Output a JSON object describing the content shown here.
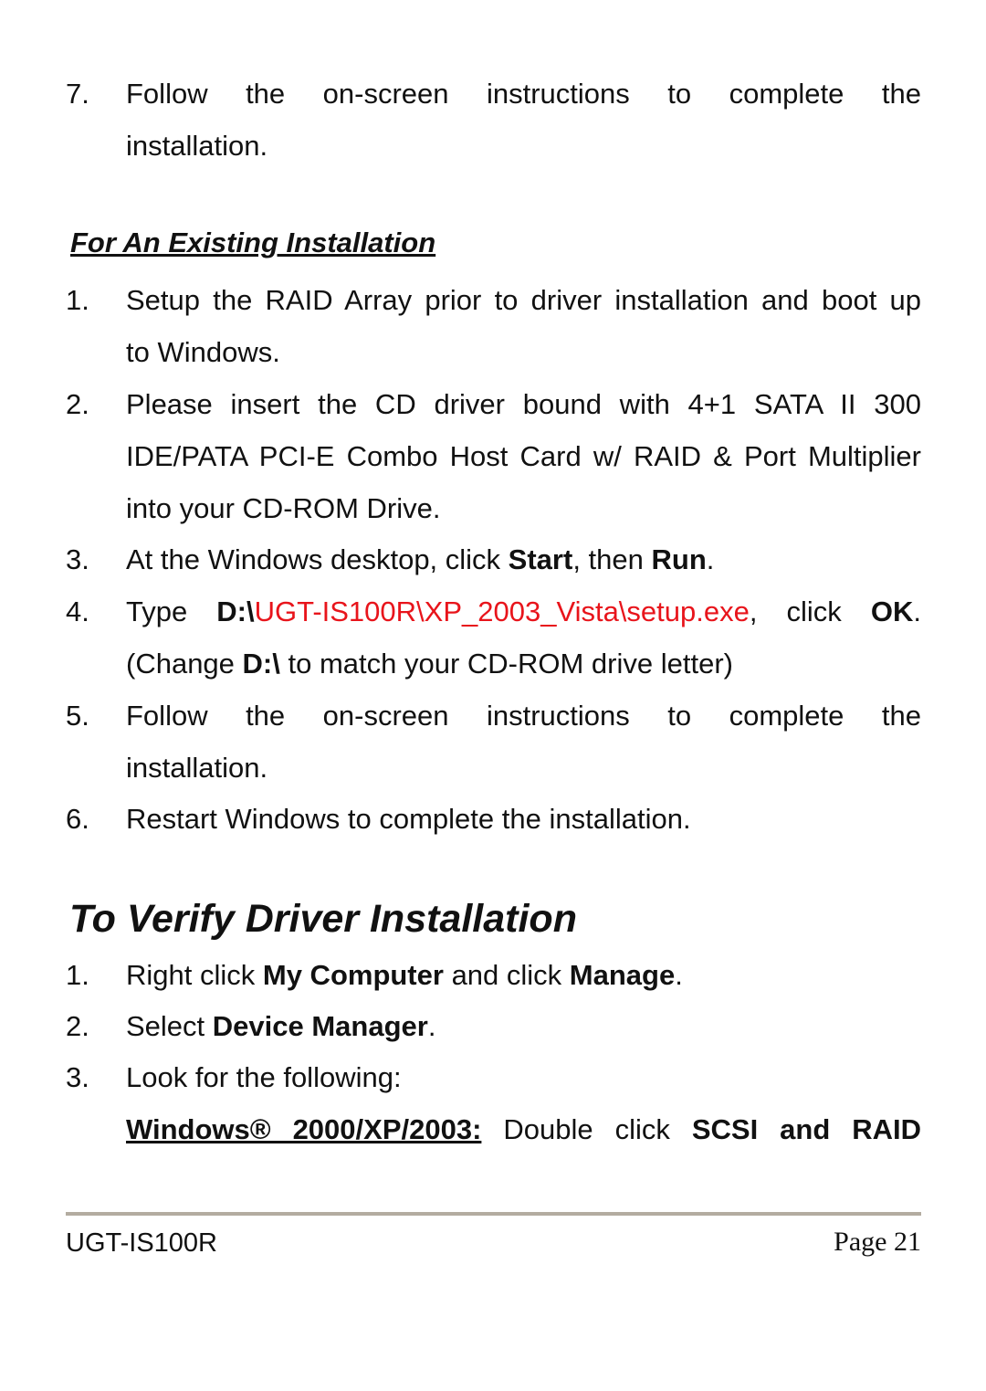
{
  "prev_section": {
    "step7": {
      "num": "7.",
      "line1": "Follow the on-screen instructions to complete the",
      "line2": "installation."
    }
  },
  "existing": {
    "heading": "For An Existing Installation",
    "steps": [
      {
        "num": "1.",
        "line1": "Setup the RAID Array prior to driver installation and boot up",
        "line2": "to Windows."
      },
      {
        "num": "2.",
        "line1": "Please insert the CD driver bound with 4+1 SATA II 300",
        "line2": "IDE/PATA PCI-E Combo Host Card w/ RAID & Port Multiplier",
        "line3": "into your CD-ROM Drive."
      },
      {
        "num": "3.",
        "pre": "At the Windows desktop, click ",
        "b1": "Start",
        "mid": ", then ",
        "b2": "Run",
        "post": "."
      },
      {
        "num": "4.",
        "pre": "Type ",
        "drive": "D:\\",
        "path": "UGT-IS100R\\XP_2003_Vista\\setup.exe",
        "mid": ", click ",
        "ok": "OK",
        "post": ".",
        "line2_pre": "(Change ",
        "line2_drive": "D:\\",
        "line2_post": " to match your CD-ROM drive letter)"
      },
      {
        "num": "5.",
        "line1": "Follow the on-screen instructions to complete the",
        "line2": "installation."
      },
      {
        "num": "6.",
        "line1": "Restart Windows to complete the installation."
      }
    ]
  },
  "verify": {
    "heading": "To Verify Driver Installation",
    "steps": [
      {
        "num": "1.",
        "pre": "Right click ",
        "b1": "My Computer",
        "mid": " and click ",
        "b2": "Manage",
        "post": "."
      },
      {
        "num": "2.",
        "pre": "Select ",
        "b1": "Device Manager",
        "post": "."
      },
      {
        "num": "3.",
        "line1": "Look for the following:"
      }
    ],
    "os_label": "Windows® 2000/XP/2003:",
    "os_pre": "Double click ",
    "os_bold": "SCSI and RAID"
  },
  "footer": {
    "model": "UGT-IS100R",
    "page": "Page 21"
  }
}
